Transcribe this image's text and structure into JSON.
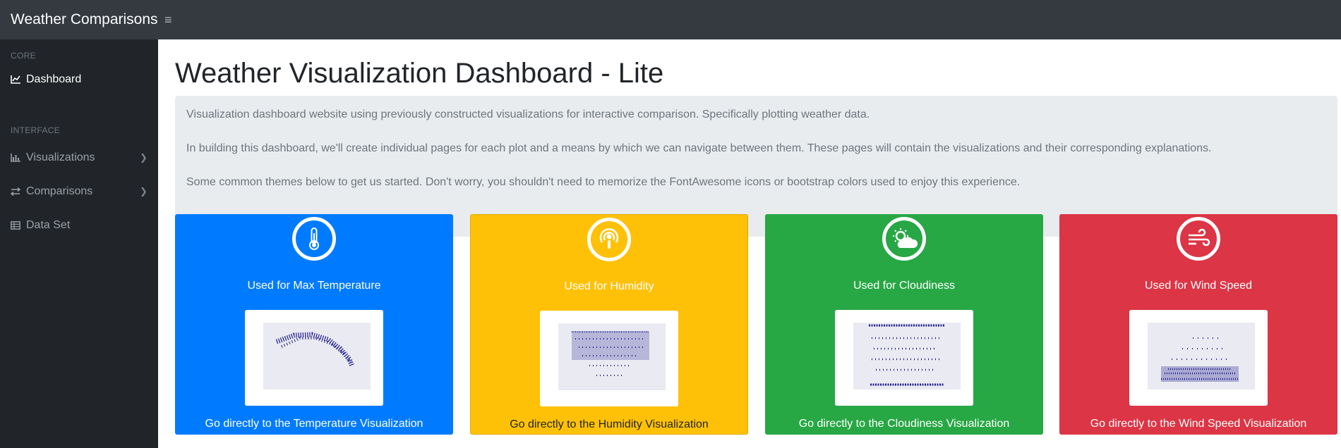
{
  "navbar": {
    "brand": "Weather Comparisons",
    "toggle_icon": "bars-icon"
  },
  "sidebar": {
    "headings": [
      "CORE",
      "INTERFACE"
    ],
    "items": [
      {
        "label": "Dashboard",
        "icon": "area-chart-icon"
      },
      {
        "label": "Visualizations",
        "icon": "bar-chart-icon"
      },
      {
        "label": "Comparisons",
        "icon": "compare-icon"
      },
      {
        "label": "Data Set",
        "icon": "table-icon"
      }
    ]
  },
  "main": {
    "title": "Weather Visualization Dashboard - Lite",
    "intro": [
      "Visualization dashboard website using previously constructed visualizations for interactive comparison. Specifically plotting weather data.",
      "In building this dashboard, we'll create individual pages for each plot and a means by which we can navigate between them. These pages will contain the visualizations and their corresponding explanations.",
      "Some common themes below to get us started. Don't worry, you shouldn't need to memorize the FontAwesome icons or bootstrap colors used to enjoy this experience."
    ],
    "cards": [
      {
        "used": "Used for Max Temperature",
        "link": "Go directly to the Temperature Visualization",
        "icon": "thermometer-icon",
        "color": "#007bff"
      },
      {
        "used": "Used for Humidity",
        "link": "Go directly to the Humidity Visualization",
        "icon": "podcast-icon",
        "color": "#ffc107"
      },
      {
        "used": "Used for Cloudiness",
        "link": "Go directly to the Cloudiness Visualization",
        "icon": "cloud-sun-icon",
        "color": "#28a745"
      },
      {
        "used": "Used for Wind Speed",
        "link": "Go directly to the Wind Speed Visualization",
        "icon": "wind-icon",
        "color": "#dc3545"
      }
    ]
  }
}
